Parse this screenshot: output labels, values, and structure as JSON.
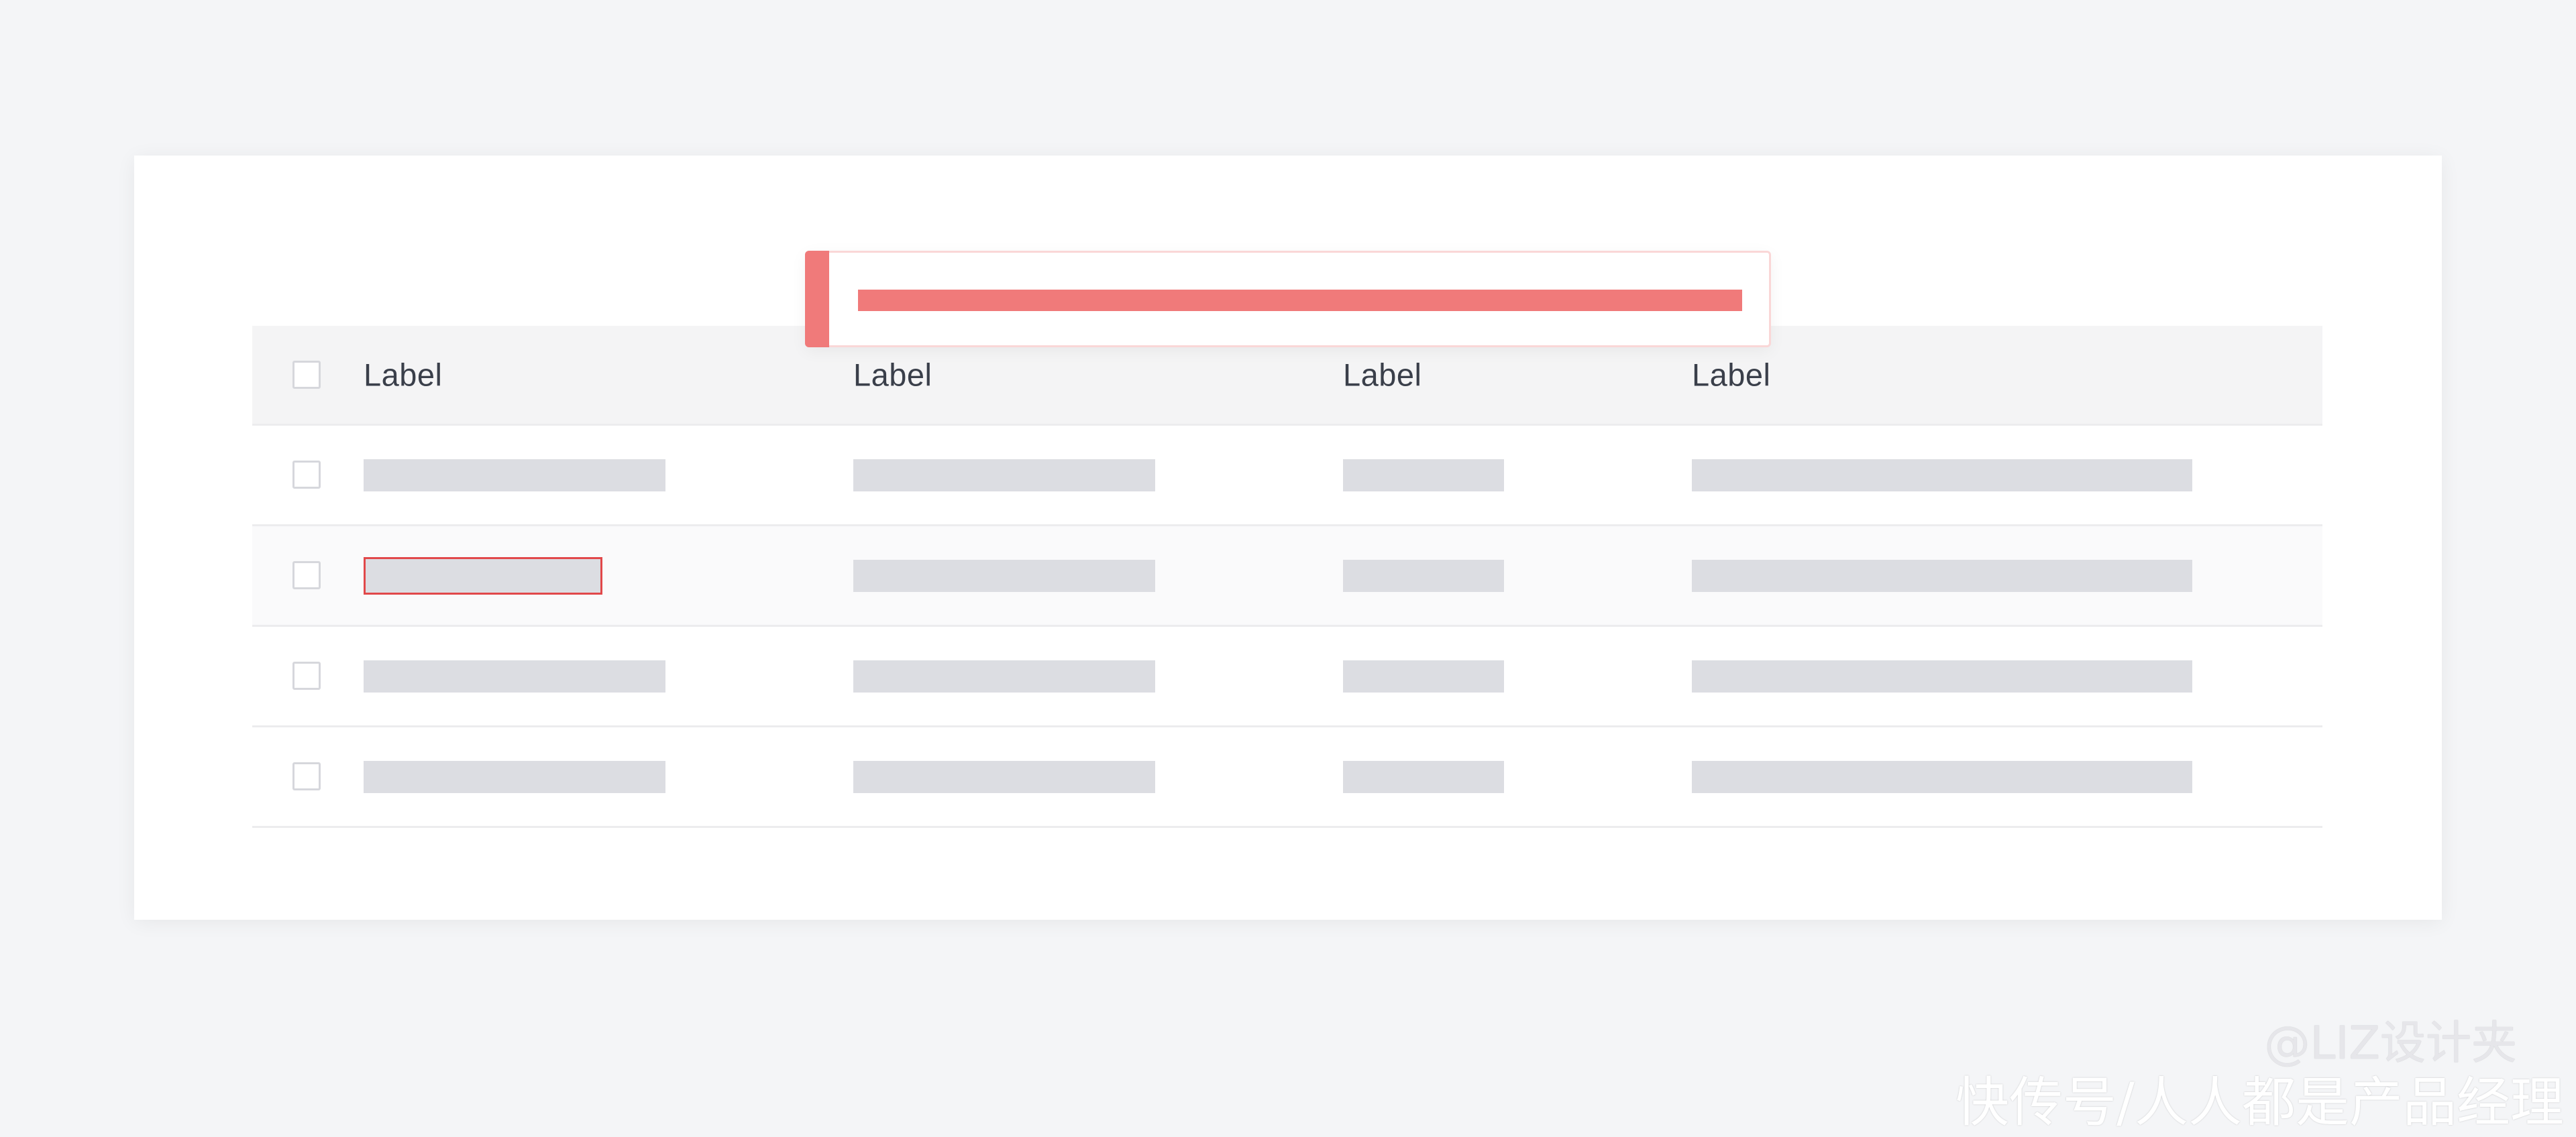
{
  "table": {
    "headers": [
      "Label",
      "Label",
      "Label",
      "Label"
    ],
    "rows": [
      {
        "state": "normal",
        "cells": [
          "",
          "",
          "",
          ""
        ]
      },
      {
        "state": "error",
        "cells": [
          "",
          "",
          "",
          ""
        ]
      },
      {
        "state": "normal",
        "cells": [
          "",
          "",
          "",
          ""
        ]
      },
      {
        "state": "normal",
        "cells": [
          "",
          "",
          "",
          ""
        ]
      }
    ]
  },
  "toast": {
    "type": "error",
    "icon": "error-accent-bar",
    "message": ""
  },
  "colors": {
    "page_background": "#f4f5f7",
    "card_background": "#ffffff",
    "header_background": "#f4f4f5",
    "skeleton": "#dcdde2",
    "error_accent": "#f07a7a",
    "error_border": "#e1484a",
    "label_text": "#3a3f4a"
  },
  "watermark": {
    "handle": "@LIZ设计夹",
    "source": "快传号/人人都是产品经理"
  }
}
